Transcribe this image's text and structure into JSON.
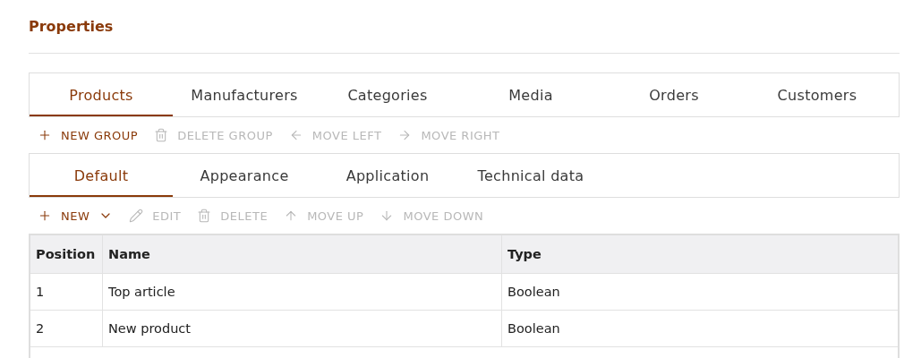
{
  "title": "Properties",
  "group_tabs": [
    {
      "label": "Products",
      "selected": true
    },
    {
      "label": "Manufacturers",
      "selected": false
    },
    {
      "label": "Categories",
      "selected": false
    },
    {
      "label": "Media",
      "selected": false
    },
    {
      "label": "Orders",
      "selected": false
    },
    {
      "label": "Customers",
      "selected": false
    }
  ],
  "group_actions": [
    {
      "kind": "plus",
      "label": "NEW GROUP",
      "disabled": false
    },
    {
      "kind": "trash",
      "label": "DELETE GROUP",
      "disabled": true
    },
    {
      "kind": "left",
      "label": "MOVE LEFT",
      "disabled": true
    },
    {
      "kind": "right",
      "label": "MOVE RIGHT",
      "disabled": true
    }
  ],
  "sub_tabs": [
    {
      "label": "Default",
      "selected": true
    },
    {
      "label": "Appearance",
      "selected": false
    },
    {
      "label": "Application",
      "selected": false
    },
    {
      "label": "Technical data",
      "selected": false
    }
  ],
  "property_actions": [
    {
      "kind": "plus-menu",
      "label": "NEW",
      "disabled": false
    },
    {
      "kind": "pencil",
      "label": "EDIT",
      "disabled": true
    },
    {
      "kind": "trash",
      "label": "DELETE",
      "disabled": true
    },
    {
      "kind": "up",
      "label": "MOVE UP",
      "disabled": true
    },
    {
      "kind": "down",
      "label": "MOVE DOWN",
      "disabled": true
    }
  ],
  "table": {
    "columns": [
      "Position",
      "Name",
      "Type"
    ],
    "rows": [
      [
        "1",
        "Top article",
        "Boolean"
      ],
      [
        "2",
        "New product",
        "Boolean"
      ]
    ]
  }
}
